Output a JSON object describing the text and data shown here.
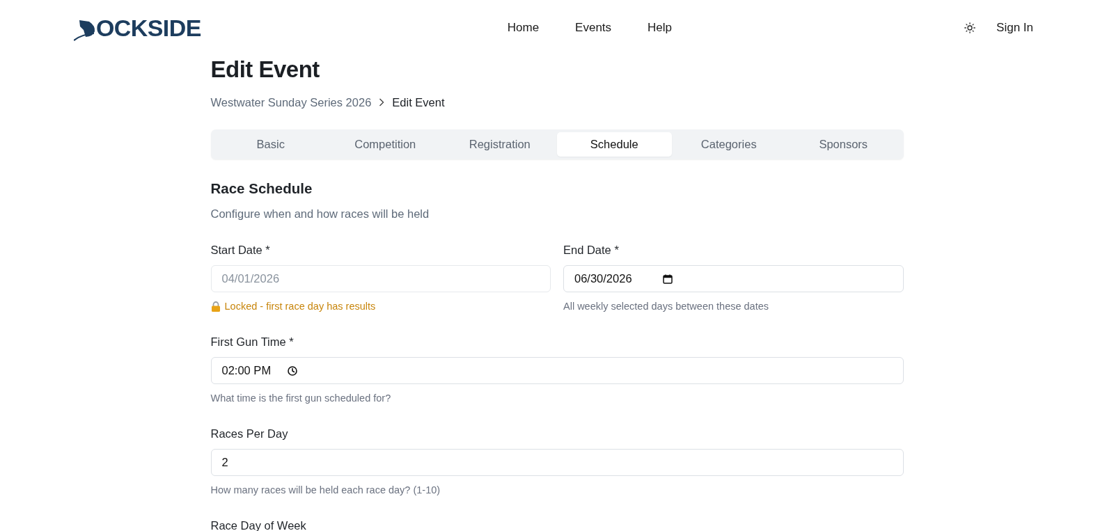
{
  "header": {
    "logo": {
      "text": "OCKSIDE"
    },
    "nav": [
      {
        "label": "Home"
      },
      {
        "label": "Events"
      },
      {
        "label": "Help"
      }
    ],
    "sign_in": "Sign In"
  },
  "page": {
    "title": "Edit Event",
    "breadcrumb": [
      {
        "label": "Westwater Sunday Series 2026",
        "current": false
      },
      {
        "label": "Edit Event",
        "current": true
      }
    ]
  },
  "tabs": [
    {
      "label": "Basic",
      "selected": false
    },
    {
      "label": "Competition",
      "selected": false
    },
    {
      "label": "Registration",
      "selected": false
    },
    {
      "label": "Schedule",
      "selected": true
    },
    {
      "label": "Categories",
      "selected": false
    },
    {
      "label": "Sponsors",
      "selected": false
    }
  ],
  "section": {
    "title": "Race Schedule",
    "subtitle": "Configure when and how races will be held"
  },
  "rows": [
    {
      "fields": [
        {
          "label": "Start Date *",
          "kind": "date",
          "value": "04/01/2026",
          "disabled": true,
          "hint": {
            "text": "Locked - first race day has results",
            "kind": "locked"
          }
        },
        {
          "label": "End Date *",
          "kind": "date",
          "value": "06/30/2026",
          "disabled": false,
          "hint": {
            "text": "All weekly selected days between these dates",
            "kind": "info"
          }
        }
      ]
    },
    {
      "fields": [
        {
          "label": "First Gun Time *",
          "kind": "time",
          "value": "02:00 PM",
          "disabled": false,
          "hint": {
            "text": "What time is the first gun scheduled for?",
            "kind": "info"
          }
        }
      ]
    },
    {
      "fields": [
        {
          "label": "Races Per Day",
          "kind": "number",
          "value": "2",
          "disabled": false,
          "hint": {
            "text": "How many races will be held each race day? (1-10)",
            "kind": "info"
          }
        }
      ]
    },
    {
      "fields": [
        {
          "label": "Race Day of Week"
        }
      ]
    }
  ]
}
